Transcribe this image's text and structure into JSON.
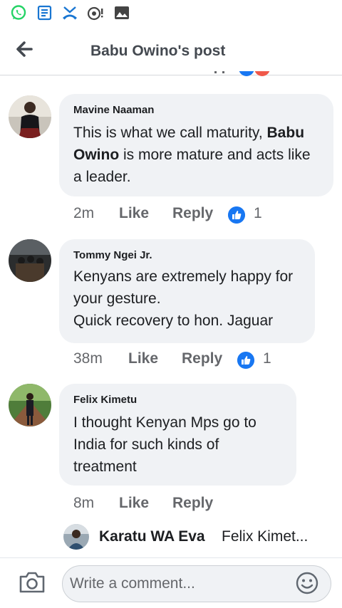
{
  "status_bar": {
    "icons": [
      "whatsapp-icon",
      "news-icon",
      "missed-call-icon",
      "camera-notification-icon",
      "gallery-icon"
    ]
  },
  "header": {
    "title": "Babu Owino's post",
    "back_icon": "arrow-left-icon"
  },
  "comments": [
    {
      "author": "Mavine Naaman",
      "text_before": "This is what we call maturity, ",
      "mention": "Babu Owino",
      "text_after": " is more mature and acts like a leader.",
      "time": "2m",
      "like_label": "Like",
      "reply_label": "Reply",
      "reaction_count": "1"
    },
    {
      "author": "Tommy Ngei Jr.",
      "text_line1": "Kenyans are extremely happy for your gesture.",
      "text_line2": "Quick recovery to hon. Jaguar",
      "time": "38m",
      "like_label": "Like",
      "reply_label": "Reply",
      "reaction_count": "1"
    },
    {
      "author": "Felix Kimetu",
      "text": "I thought Kenyan Mps go to India for such kinds of treatment",
      "time": "8m",
      "like_label": "Like",
      "reply_label": "Reply"
    }
  ],
  "reply_preview": {
    "author": "Karatu WA Eva",
    "snippet": "Felix Kimet..."
  },
  "composer": {
    "placeholder": "Write a comment..."
  },
  "colors": {
    "bubble": "#f0f2f5",
    "like_blue": "#1877f2",
    "secondary_text": "#65676b",
    "whatsapp_green": "#25d366",
    "status_icon_blue": "#1976d2"
  }
}
